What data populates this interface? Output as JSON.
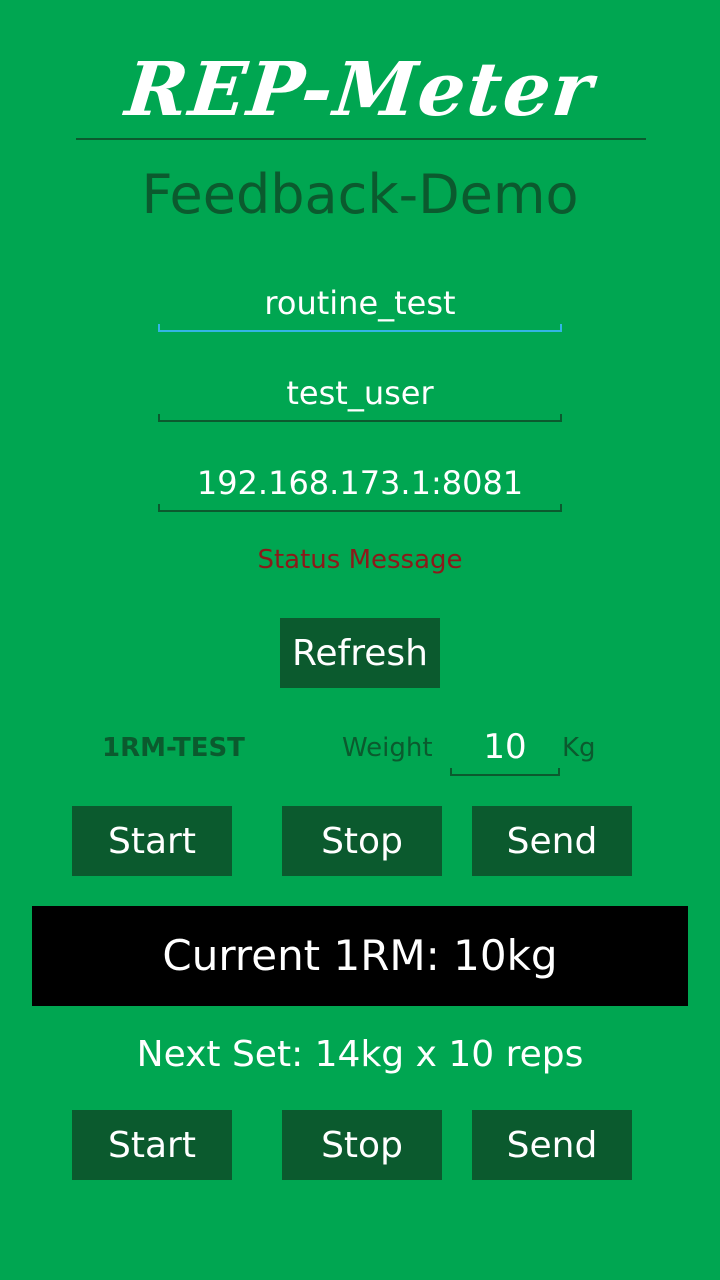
{
  "app": {
    "logo_text": "REP-Meter",
    "subtitle": "Feedback-Demo"
  },
  "fields": {
    "routine": "routine_test",
    "user": "test_user",
    "server": "192.168.173.1:8081"
  },
  "status_message": "Status Message",
  "refresh_label": "Refresh",
  "test_row": {
    "label": "1RM-TEST",
    "weight_label": "Weight",
    "weight_value": "10",
    "unit": "Kg"
  },
  "controls_top": {
    "start": "Start",
    "stop": "Stop",
    "send": "Send"
  },
  "current_1rm": "Current 1RM: 10kg",
  "next_set": "Next Set: 14kg x 10 reps",
  "controls_bottom": {
    "start": "Start",
    "stop": "Stop",
    "send": "Send"
  },
  "colors": {
    "background": "#00a651",
    "dark_green": "#0b5a2e",
    "status_red": "#8b1a1a",
    "focus_blue": "#33b5e5",
    "banner": "#000000"
  }
}
